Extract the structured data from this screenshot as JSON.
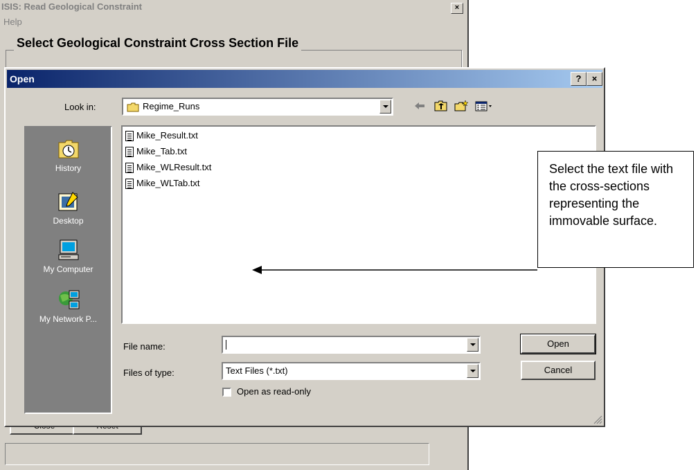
{
  "parent_window": {
    "title": "ISIS: Read Geological Constraint",
    "close_glyph": "×",
    "menu": [
      "Help"
    ],
    "group_title": "Select Geological Constraint Cross Section File",
    "buttons": [
      "Close",
      "Reset"
    ]
  },
  "dialog": {
    "title": "Open",
    "help_glyph": "?",
    "close_glyph": "×",
    "look_in_label": "Look in:",
    "look_in_value": "Regime_Runs",
    "toolbar_icons": [
      "back-arrow-icon",
      "up-folder-icon",
      "new-folder-icon",
      "view-menu-icon"
    ],
    "places": [
      {
        "label": "History",
        "icon": "history-icon"
      },
      {
        "label": "Desktop",
        "icon": "desktop-icon"
      },
      {
        "label": "My Computer",
        "icon": "my-computer-icon"
      },
      {
        "label": "My Network P...",
        "icon": "network-places-icon"
      }
    ],
    "files": [
      "Mike_Result.txt",
      "Mike_Tab.txt",
      "Mike_WLResult.txt",
      "Mike_WLTab.txt"
    ],
    "file_name_label": "File name:",
    "file_name_value": "",
    "files_of_type_label": "Files of type:",
    "files_of_type_value": "Text Files (*.txt)",
    "read_only_label": "Open as read-only",
    "read_only_checked": false,
    "open_label": "Open",
    "cancel_label": "Cancel"
  },
  "callout": {
    "text": "Select the text file with the cross-sections representing the immovable surface."
  },
  "colors": {
    "title_bar_start": "#0a246a",
    "title_bar_end": "#a6caf0",
    "window_face": "#d4d0c8",
    "places_bg": "#808080"
  }
}
